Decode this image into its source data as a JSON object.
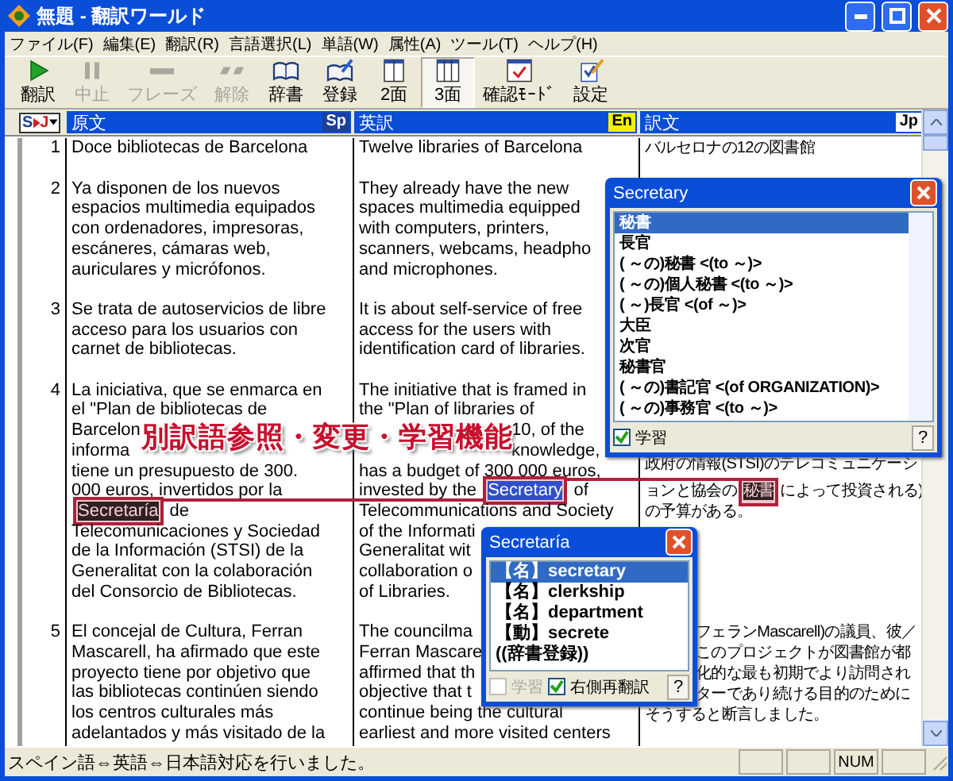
{
  "window": {
    "title": "無題 - 翻訳ワールド"
  },
  "menu": [
    "ファイル(F)",
    "編集(E)",
    "翻訳(R)",
    "言語選択(L)",
    "単語(W)",
    "属性(A)",
    "ツール(T)",
    "ヘルプ(H)"
  ],
  "toolbar": [
    {
      "label": "翻訳",
      "kind": "play",
      "disabled": false,
      "selected": false
    },
    {
      "label": "中止",
      "kind": "pause",
      "disabled": true,
      "selected": false
    },
    {
      "label": "フレーズ",
      "kind": "bar",
      "disabled": true,
      "selected": false
    },
    {
      "label": "解除",
      "kind": "split",
      "disabled": true,
      "selected": false
    },
    {
      "label": "辞書",
      "kind": "book",
      "disabled": false,
      "selected": false
    },
    {
      "label": "登録",
      "kind": "register",
      "disabled": false,
      "selected": false
    },
    {
      "label": "2面",
      "kind": "twopane",
      "disabled": false,
      "selected": false
    },
    {
      "label": "3面",
      "kind": "threepane",
      "disabled": false,
      "selected": true
    },
    {
      "label": "確認ﾓｰﾄﾞ",
      "kind": "check",
      "disabled": false,
      "selected": false
    },
    {
      "label": "設定",
      "kind": "settings",
      "disabled": false,
      "selected": false
    }
  ],
  "language_selector": {
    "source": "S",
    "target": "J"
  },
  "columns": [
    {
      "label": "原文",
      "badge": "Sp",
      "color": "#1c3f9c"
    },
    {
      "label": "英訳",
      "badge": "En",
      "color": "#f2f200"
    },
    {
      "label": "訳文",
      "badge": "Jp",
      "color": "#ffffff"
    }
  ],
  "rows": [
    {
      "number": "1",
      "source": [
        "Doce bibliotecas de Barcelona"
      ],
      "english": [
        "Twelve libraries of Barcelona"
      ],
      "japanese": {
        "kind": "plain",
        "lines": [
          "バルセロナの12の図書館"
        ]
      }
    },
    {
      "number": "2",
      "source": [
        "Ya disponen de los nuevos",
        "espacios multimedia equipados",
        "con ordenadores, impresoras,",
        "escáneres, cámaras web,",
        "auriculares y micrófonos."
      ],
      "english": [
        "They already have the new",
        "spaces multimedia equipped",
        "with computers, printers,",
        "scanners, webcams, headpho",
        "and microphones."
      ],
      "japanese": {
        "kind": "covered"
      }
    },
    {
      "number": "3",
      "source": [
        "Se trata de autoservicios de libre",
        "acceso para los usuarios con",
        "carnet de bibliotecas."
      ],
      "english": [
        "It is about self-service of free",
        "access for the users with",
        "identification card of libraries."
      ],
      "japanese": {
        "kind": "covered"
      }
    },
    {
      "number": "4",
      "source": [
        "La iniciativa, que se enmarca en",
        "el \"Plan de bibliotecas de",
        "Barcelon",
        "informa",
        "tiene un presupuesto de 300.",
        "000 euros, invertidos por la",
        {
          "parts": [
            {
              "text": "Secretaría",
              "kind": "dark"
            },
            {
              "text": " de",
              "kind": "plain"
            }
          ]
        },
        "Telecomunicaciones y Sociedad",
        "de la Información (STSI) de la",
        "Generalitat con la colaboración",
        "del Consorcio de Bibliotecas."
      ],
      "english": [
        "The initiative that is framed in",
        "the \"Plan of libraries of",
        {
          "text": "10, of the",
          "kind": "tail"
        },
        {
          "text": "knowledge,",
          "kind": "tail"
        },
        "has a budget of 300 000 euros,",
        {
          "parts": [
            {
              "text": "invested by the ",
              "kind": "plain"
            },
            {
              "text": "Secretary",
              "kind": "selected"
            },
            {
              "text": " of",
              "kind": "plain"
            }
          ]
        },
        "Telecommunications and Society",
        "of the Informati",
        "Generalitat wit",
        "collaboration o",
        "of Libraries."
      ],
      "japanese": {
        "kind": "covered_top",
        "lines": [
          "政府の情報(STSI)のテレコミュニケーシ",
          {
            "parts": [
              {
                "text": "ョンと協会の",
                "kind": "plain"
              },
              {
                "text": "秘書",
                "kind": "dark"
              },
              {
                "text": "によって投資される)",
                "kind": "plain"
              }
            ]
          },
          "の予算がある。"
        ]
      }
    },
    {
      "number": "5",
      "source": [
        "El concejal de Cultura, Ferran",
        "Mascarell, ha afirmado que este",
        "proyecto tiene por objetivo que",
        "las bibliotecas continúen siendo",
        "los centros culturales más",
        "adelantados y más visitado de la"
      ],
      "english": [
        "The councilma",
        "Ferran Mascare",
        "affirmed that th",
        "objective that t",
        "continue being the cultural",
        "earliest and more visited centers"
      ],
      "japanese": {
        "kind": "plain",
        "lines": [
          {
            "text": "フェランMascarell)の議員、彼／",
            "kind": "tail"
          },
          {
            "text": "このプロジェクトが図書館が都",
            "kind": "tail"
          },
          {
            "text": "化的な最も初期でより訪問され",
            "kind": "tail"
          },
          {
            "text": "ターであり続ける目的のために",
            "kind": "tail"
          },
          "そうすると断言しました。"
        ]
      }
    }
  ],
  "callout": {
    "text": "別訳語参照・変更・学習機能"
  },
  "popups": [
    {
      "title": "Secretary",
      "items": [
        {
          "text": "秘書",
          "selected": true
        },
        {
          "text": "長官",
          "selected": false
        },
        {
          "text": "( ～の)秘書 <(to ～)>",
          "selected": false
        },
        {
          "text": "( ～の)個人秘書 <(to ～)>",
          "selected": false
        },
        {
          "text": "( ～)長官 <(of ～)>",
          "selected": false
        },
        {
          "text": "大臣",
          "selected": false
        },
        {
          "text": "次官",
          "selected": false
        },
        {
          "text": "秘書官",
          "selected": false
        },
        {
          "text": "( ～の)書記官 <(of ORGANIZATION)>",
          "selected": false
        },
        {
          "text": "( ～の)事務官 <(to ～)>",
          "selected": false
        }
      ],
      "options": [
        {
          "label": "学習",
          "checked": true,
          "disabled": false
        }
      ],
      "help": "?"
    },
    {
      "title": "Secretaría",
      "items": [
        {
          "text": "【名】secretary",
          "selected": true
        },
        {
          "text": "【名】clerkship",
          "selected": false
        },
        {
          "text": "【名】department",
          "selected": false
        },
        {
          "text": "【動】secrete",
          "selected": false
        },
        {
          "text": "((辞書登録))",
          "selected": false
        }
      ],
      "options": [
        {
          "label": "学習",
          "checked": false,
          "disabled": true
        },
        {
          "label": "右側再翻訳",
          "checked": true,
          "disabled": false
        }
      ],
      "help": "?"
    }
  ],
  "status_bar": {
    "text": "スペイン語⇔英語⇔日本語対応を行いました。",
    "indicators": [
      "NUM"
    ]
  }
}
